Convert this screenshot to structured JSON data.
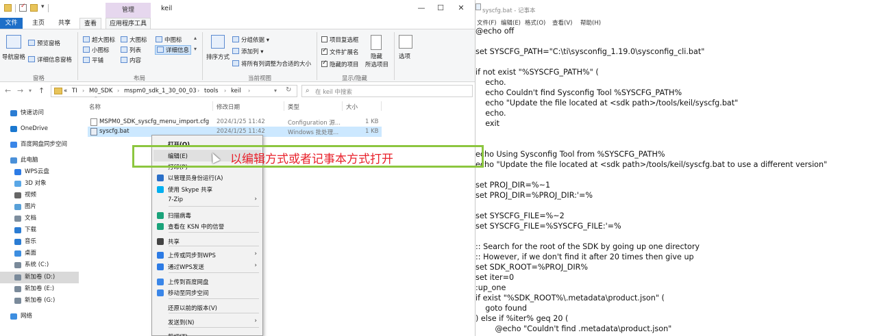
{
  "explorer": {
    "title": "keil",
    "context_tab": "管理",
    "tabs": [
      "文件",
      "主页",
      "共享",
      "查看",
      "应用程序工具"
    ],
    "window_controls": {
      "minimize": "—",
      "maximize": "☐",
      "close": "✕"
    },
    "ribbon": {
      "pane": {
        "nav_pane": "导航窗格",
        "preview_pane": "预览窗格",
        "details_pane": "详细信息窗格",
        "label": "窗格"
      },
      "layout": {
        "items": [
          "超大图标",
          "大图标",
          "中图标",
          "小图标",
          "列表",
          "详细信息",
          "平铺",
          "内容"
        ],
        "selected": "详细信息",
        "label": "布局"
      },
      "current_view": {
        "sort": "排序方式",
        "group": "分组依据 ▾",
        "add_column": "添加列 ▾",
        "fit_columns": "将所有列调整为合适的大小",
        "label": "当前视图"
      },
      "show_hide": {
        "item_checkbox": "项目复选框",
        "file_ext": "文件扩展名",
        "hidden_items": "隐藏的项目",
        "hide": "隐藏",
        "hide_selected": "所选项目",
        "options": "选项",
        "label": "显示/隐藏"
      }
    },
    "address": {
      "crumbs": [
        "«",
        "TI",
        "M0_SDK",
        "mspm0_sdk_1_30_00_03",
        "tools",
        "keil"
      ],
      "search_placeholder": "在 keil 中搜索"
    },
    "nav_items": [
      {
        "label": "快速访问",
        "icon": "star-icon",
        "color": "#2b7cd3"
      },
      {
        "label": "OneDrive",
        "icon": "cloud-icon",
        "color": "#1b78d0"
      },
      {
        "label": "百度网盘同步空间",
        "icon": "baidu-icon",
        "color": "#3a86e8"
      },
      {
        "label": "此电脑",
        "icon": "computer-icon",
        "color": "#4a90d9"
      },
      {
        "label": "WPS云盘",
        "icon": "wps-cloud-icon",
        "color": "#2d7be5"
      },
      {
        "label": "3D 对象",
        "icon": "cube-icon",
        "color": "#5aa7e6"
      },
      {
        "label": "视频",
        "icon": "video-icon",
        "color": "#666"
      },
      {
        "label": "图片",
        "icon": "picture-icon",
        "color": "#58a0d8"
      },
      {
        "label": "文档",
        "icon": "document-icon",
        "color": "#7d8d9d"
      },
      {
        "label": "下载",
        "icon": "download-icon",
        "color": "#2b7cd3"
      },
      {
        "label": "音乐",
        "icon": "music-icon",
        "color": "#2b7cd3"
      },
      {
        "label": "桌面",
        "icon": "desktop-icon",
        "color": "#3d8ee0"
      },
      {
        "label": "系统 (C:)",
        "icon": "drive-icon",
        "color": "#7a8a9a"
      },
      {
        "label": "新加卷 (D:)",
        "icon": "drive-icon",
        "color": "#7a8a9a"
      },
      {
        "label": "新加卷 (E:)",
        "icon": "drive-icon",
        "color": "#7a8a9a"
      },
      {
        "label": "新加卷 (G:)",
        "icon": "drive-icon",
        "color": "#7a8a9a"
      },
      {
        "label": "网络",
        "icon": "network-icon",
        "color": "#3d8ee0"
      }
    ],
    "columns": [
      "名称",
      "修改日期",
      "类型",
      "大小"
    ],
    "files": [
      {
        "name": "MSPM0_SDK_syscfg_menu_import.cfg",
        "date": "2024/1/25 11:42",
        "type": "Configuration 源...",
        "size": "1 KB"
      },
      {
        "name": "syscfg.bat",
        "date": "2024/1/25 11:42",
        "type": "Windows 批处理...",
        "size": "1 KB"
      }
    ]
  },
  "context_menu": [
    {
      "label": "打开(O)",
      "bold": true
    },
    {
      "label": "编辑(E)"
    },
    {
      "label": "打印(P)"
    },
    {
      "label": "以管理员身份运行(A)",
      "icon": "shield-icon"
    },
    {
      "label": "使用 Skype 共享",
      "icon": "skype-icon"
    },
    {
      "label": "7-Zip",
      "submenu": true
    },
    {
      "label": "扫描病毒",
      "icon": "kaspersky-icon"
    },
    {
      "label": "查看在 KSN 中的信誉",
      "icon": "kaspersky-icon"
    },
    {
      "label": "共享",
      "icon": "share-icon"
    },
    {
      "label": "上传或同步到WPS",
      "icon": "wps-cloud-icon",
      "submenu": true
    },
    {
      "label": "通过WPS发送",
      "icon": "wps-send-icon",
      "submenu": true
    },
    {
      "label": "上传到百度网盘",
      "icon": "baidu-icon"
    },
    {
      "label": "移动至同步空间",
      "icon": "baidu-icon"
    },
    {
      "label": "还原以前的版本(V)"
    },
    {
      "label": "发送到(N)",
      "submenu": true
    },
    {
      "label": "剪切(T)"
    }
  ],
  "annotation": {
    "text": "以编辑方式或者记事本方式打开"
  },
  "notepad": {
    "title": "syscfg.bat - 记事本",
    "menu": [
      "文件(F)",
      "编辑(E)",
      "格式(O)",
      "查看(V)",
      "帮助(H)"
    ],
    "lines": [
      "@echo off",
      "",
      "set SYSCFG_PATH=\"C:\\ti\\sysconfig_1.19.0\\sysconfig_cli.bat\"",
      "",
      "if not exist \"%SYSCFG_PATH%\" (",
      "    echo.",
      "    echo Couldn't find Sysconfig Tool %SYSCFG_PATH%",
      "    echo \"Update the file located at <sdk path>/tools/keil/syscfg.bat\"",
      "    echo.",
      "    exit",
      "",
      "",
      "echo Using Sysconfig Tool from %SYSCFG_PATH%",
      "echo \"Update the file located at <sdk path>/tools/keil/syscfg.bat to use a different version\"",
      "",
      "set PROJ_DIR=%~1",
      "set PROJ_DIR=%PROJ_DIR:'=%",
      "",
      "set SYSCFG_FILE=%~2",
      "set SYSCFG_FILE=%SYSCFG_FILE:'=%",
      "",
      ":: Search for the root of the SDK by going up one directory",
      ":: However, if we don't find it after 20 times then give up",
      "set SDK_ROOT=%PROJ_DIR%",
      "set iter=0",
      ":up_one",
      "if exist \"%SDK_ROOT%\\.metadata\\product.json\" (",
      "    goto found",
      ") else if %iter% geq 20 (",
      "        @echo \"Couldn't find .metadata\\product.json\""
    ]
  }
}
